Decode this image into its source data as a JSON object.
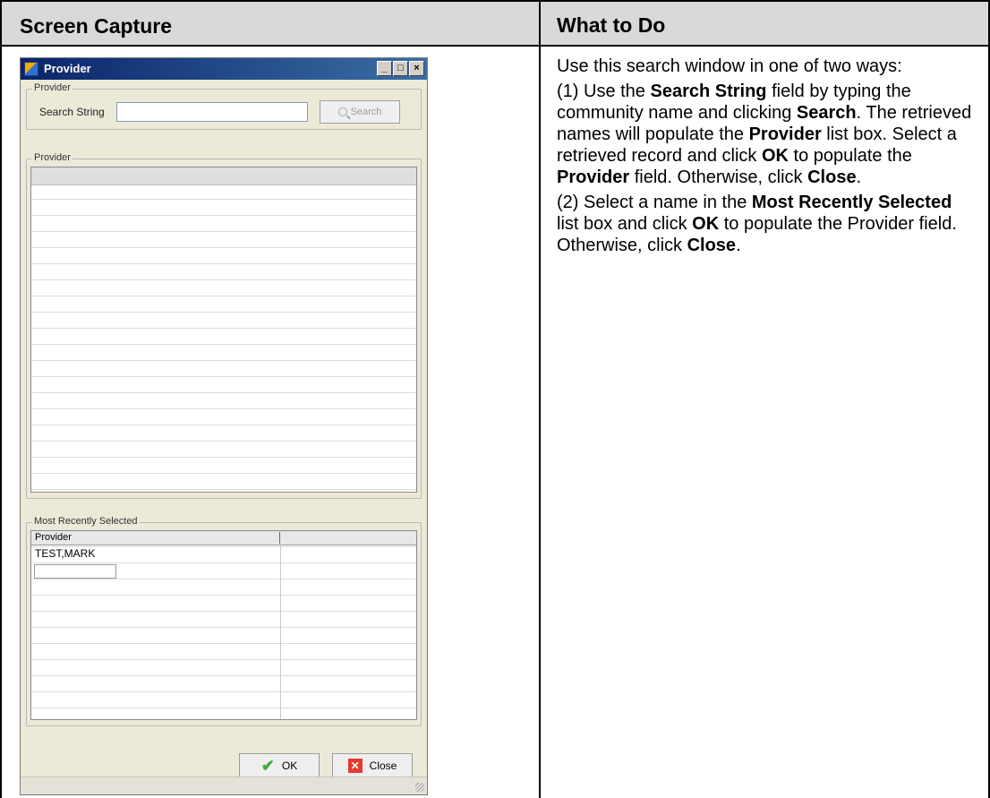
{
  "table": {
    "col1_header": "Screen Capture",
    "col2_header": "What to Do"
  },
  "dialog": {
    "title": "Provider",
    "window_controls": {
      "minimize": "_",
      "maximize": "□",
      "close": "×"
    },
    "search_group": {
      "label": "Provider",
      "search_string_label": "Search String",
      "search_value": "",
      "search_button": "Search"
    },
    "provider_list": {
      "label": "Provider",
      "items": []
    },
    "recent": {
      "label": "Most Recently Selected",
      "column_header": "Provider",
      "rows": [
        "TEST,MARK"
      ]
    },
    "buttons": {
      "ok": "OK",
      "close": "Close"
    }
  },
  "instructions": {
    "intro": "Use this search window in one of two ways:",
    "step1": {
      "t1": "(1) Use the ",
      "b1": "Search String",
      "t2": " field by typing the community name and clicking ",
      "b2": "Search",
      "t3": ". The retrieved names will populate the ",
      "b3": "Provider",
      "t4": " list box. Select a retrieved record and click ",
      "b4": "OK",
      "t5": " to populate the ",
      "b5": "Provider",
      "t6": " field. Otherwise, click ",
      "b6": "Close",
      "t7": "."
    },
    "step2": {
      "t1": "(2) Select a name in the ",
      "b1": "Most Recently Selected",
      "t2": " list box and click ",
      "b2": "OK",
      "t3": " to populate the Provider field. Otherwise, click ",
      "b3": "Close",
      "t4": "."
    }
  }
}
